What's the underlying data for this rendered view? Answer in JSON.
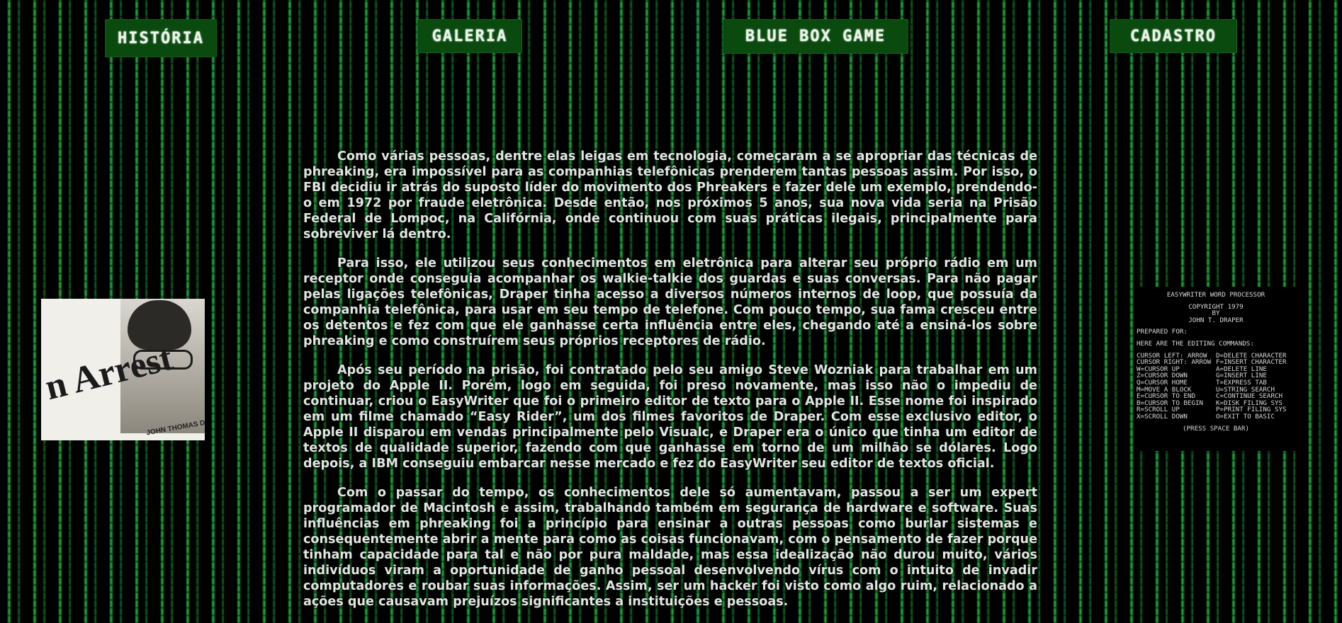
{
  "nav": {
    "historia": "História",
    "galeria": "Galeria",
    "bluebox": "Blue Box Game",
    "cadastro": "Cadastro"
  },
  "article": {
    "paragraphs": [
      "Como várias pessoas, dentre elas leigas em tecnologia, começaram a se apropriar das técnicas de phreaking, era impossível para as companhias telefônicas prenderem tantas pessoas assim. Por isso, o FBI decidiu ir atrás do suposto líder do movimento dos Phreakers e fazer dele um exemplo, prendendo-o em 1972 por fraude eletrônica. Desde então, nos próximos 5 anos, sua nova vida seria na Prisão Federal de Lompoc, na Califórnia, onde continuou com suas práticas ilegais, principalmente para sobreviver lá dentro.",
      "Para isso, ele utilizou seus conhecimentos em eletrônica para alterar seu próprio rádio em um receptor onde conseguia acompanhar os walkie-talkie dos guardas e suas conversas. Para não pagar pelas ligações telefônicas, Draper tinha acesso a diversos números internos de loop, que possuía da companhia telefônica, para usar em seu tempo de telefone. Com pouco tempo, sua fama cresceu entre os detentos e fez com que ele ganhasse certa influência entre eles, chegando até a ensiná-los sobre phreaking e como construírem seus próprios receptores de rádio.",
      "Após seu período na prisão, foi contratado pelo seu amigo Steve Wozniak para trabalhar em um projeto do Apple II. Porém, logo em seguida, foi preso novamente, mas isso não o impediu de continuar, criou o EasyWriter que foi o primeiro editor de texto para o Apple II. Esse nome foi inspirado em um filme chamado “Easy Rider”, um dos filmes favoritos de Draper. Com esse exclusivo editor, o Apple II disparou em vendas principalmente pelo Visualc, e Draper era o único que tinha um editor de textos de qualidade superior, fazendo com que ganhasse em torno de um milhão se dólares. Logo depois, a IBM conseguiu embarcar nesse mercado e fez do EasyWriter seu editor de textos oficial.",
      "Com o passar do tempo, os conhecimentos dele só aumentavam, passou a ser um expert programador de Macintosh e assim, trabalhando também em segurança de hardware e software. Suas influências em phreaking foi a princípio para ensinar a outras pessoas como burlar sistemas e consequentemente abrir a mente para como as coisas funcionavam, com o pensamento de fazer porque tinham capacidade para tal e não por pura maldade, mas essa idealização não durou muito, vários indivíduos viram a oportunidade de ganho pessoal desenvolvendo vírus com o intuito de invadir computadores e roubar suas informações. Assim, ser um hacker foi visto como algo ruim, relacionado a ações que causavam prejuízos significantes a instituições e pessoas."
    ]
  },
  "photo": {
    "headline": "n Arrest",
    "caption": "JOHN THOMAS DRA"
  },
  "terminal": {
    "title": "EASYWRITER WORD PROCESSOR",
    "copyright": "COPYRIGHT 1979",
    "by": "BY",
    "author": "JOHN T. DRAPER",
    "prepared": "PREPARED FOR:",
    "editing": "HERE ARE THE EDITING COMMANDS:",
    "commands": [
      [
        "CURSOR LEFT: ARROW",
        "D=DELETE CHARACTER"
      ],
      [
        "CURSOR RIGHT: ARROW",
        "F=INSERT CHARACTER"
      ],
      [
        "W=CURSOR UP",
        "A=DELETE LINE"
      ],
      [
        "Z=CURSOR DOWN",
        "G=INSERT LINE"
      ],
      [
        "Q=CURSOR HOME",
        "T=EXPRESS TAB"
      ],
      [
        "M=MOVE A BLOCK",
        "U=STRING SEARCH"
      ],
      [
        "E=CURSOR TO END",
        "C=CONTINUE SEARCH"
      ],
      [
        "B=CURSOR TO BEGIN",
        "K=DISK FILING SYS"
      ],
      [
        "R=SCROLL UP",
        "P=PRINT FILING SYS"
      ],
      [
        "X=SCROLL DOWN",
        "O=EXIT TO BASIC"
      ]
    ],
    "press": "(PRESS SPACE BAR)"
  },
  "colors": {
    "background": "#000000",
    "nav_button": "#0a4a0f",
    "matrix_green": "#28d250",
    "body_text": "#dfe6e0"
  }
}
